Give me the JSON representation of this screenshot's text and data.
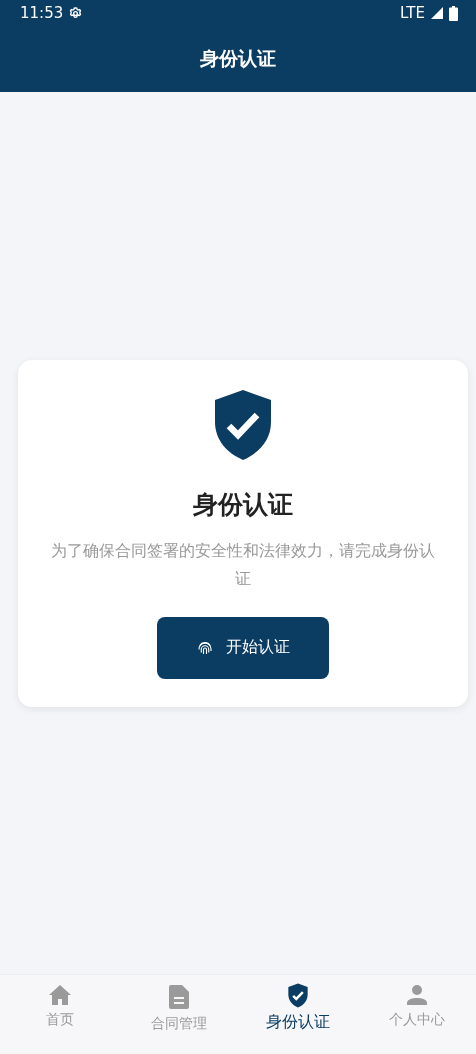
{
  "status_bar": {
    "time": "11:53",
    "network": "LTE"
  },
  "header": {
    "title": "身份认证"
  },
  "card": {
    "title": "身份认证",
    "description": "为了确保合同签署的安全性和法律效力，请完成身份认证",
    "button": "开始认证"
  },
  "tabs": [
    {
      "kind": "home",
      "label": "首页",
      "selected": false
    },
    {
      "kind": "document",
      "label": "合同管理",
      "selected": false
    },
    {
      "kind": "shield",
      "label": "身份认证",
      "selected": true
    },
    {
      "kind": "person",
      "label": "个人中心",
      "selected": false
    }
  ]
}
